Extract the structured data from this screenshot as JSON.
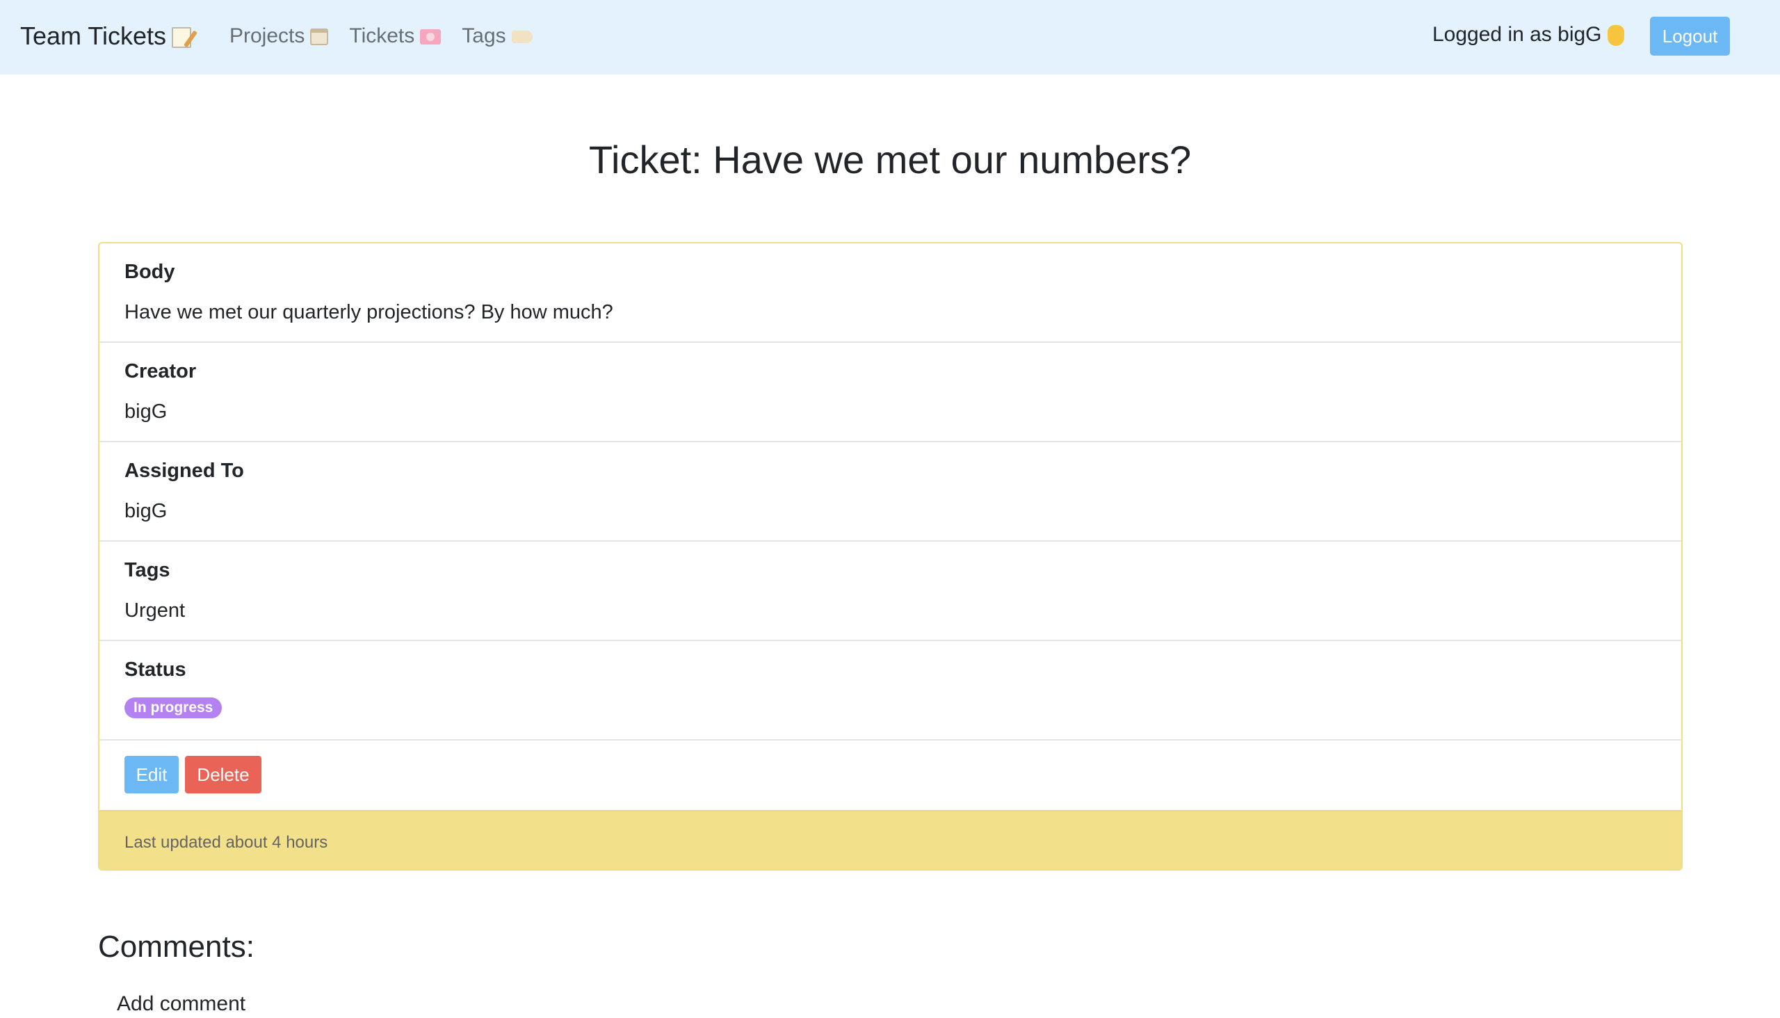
{
  "navbar": {
    "brand": "Team Tickets",
    "links": [
      {
        "label": "Projects",
        "icon": "calendar-icon"
      },
      {
        "label": "Tickets",
        "icon": "ticket-icon"
      },
      {
        "label": "Tags",
        "icon": "label-tag-icon"
      }
    ],
    "logged_in_text": "Logged in as bigG",
    "logout_label": "Logout"
  },
  "page": {
    "title": "Ticket: Have we met our numbers?"
  },
  "ticket": {
    "body_label": "Body",
    "body": "Have we met our quarterly projections? By how much?",
    "creator_label": "Creator",
    "creator": "bigG",
    "assigned_label": "Assigned To",
    "assigned": "bigG",
    "tags_label": "Tags",
    "tags": "Urgent",
    "status_label": "Status",
    "status": "In progress",
    "status_color": "#b481f1",
    "edit_label": "Edit",
    "delete_label": "Delete",
    "last_updated": "Last updated about 4 hours"
  },
  "comments": {
    "heading": "Comments:",
    "add_comment": "Add comment"
  },
  "colors": {
    "navbar_bg": "#e3f2fd",
    "primary": "#6cb8f4",
    "danger": "#e96356",
    "card_footer": "#f3e08a"
  }
}
